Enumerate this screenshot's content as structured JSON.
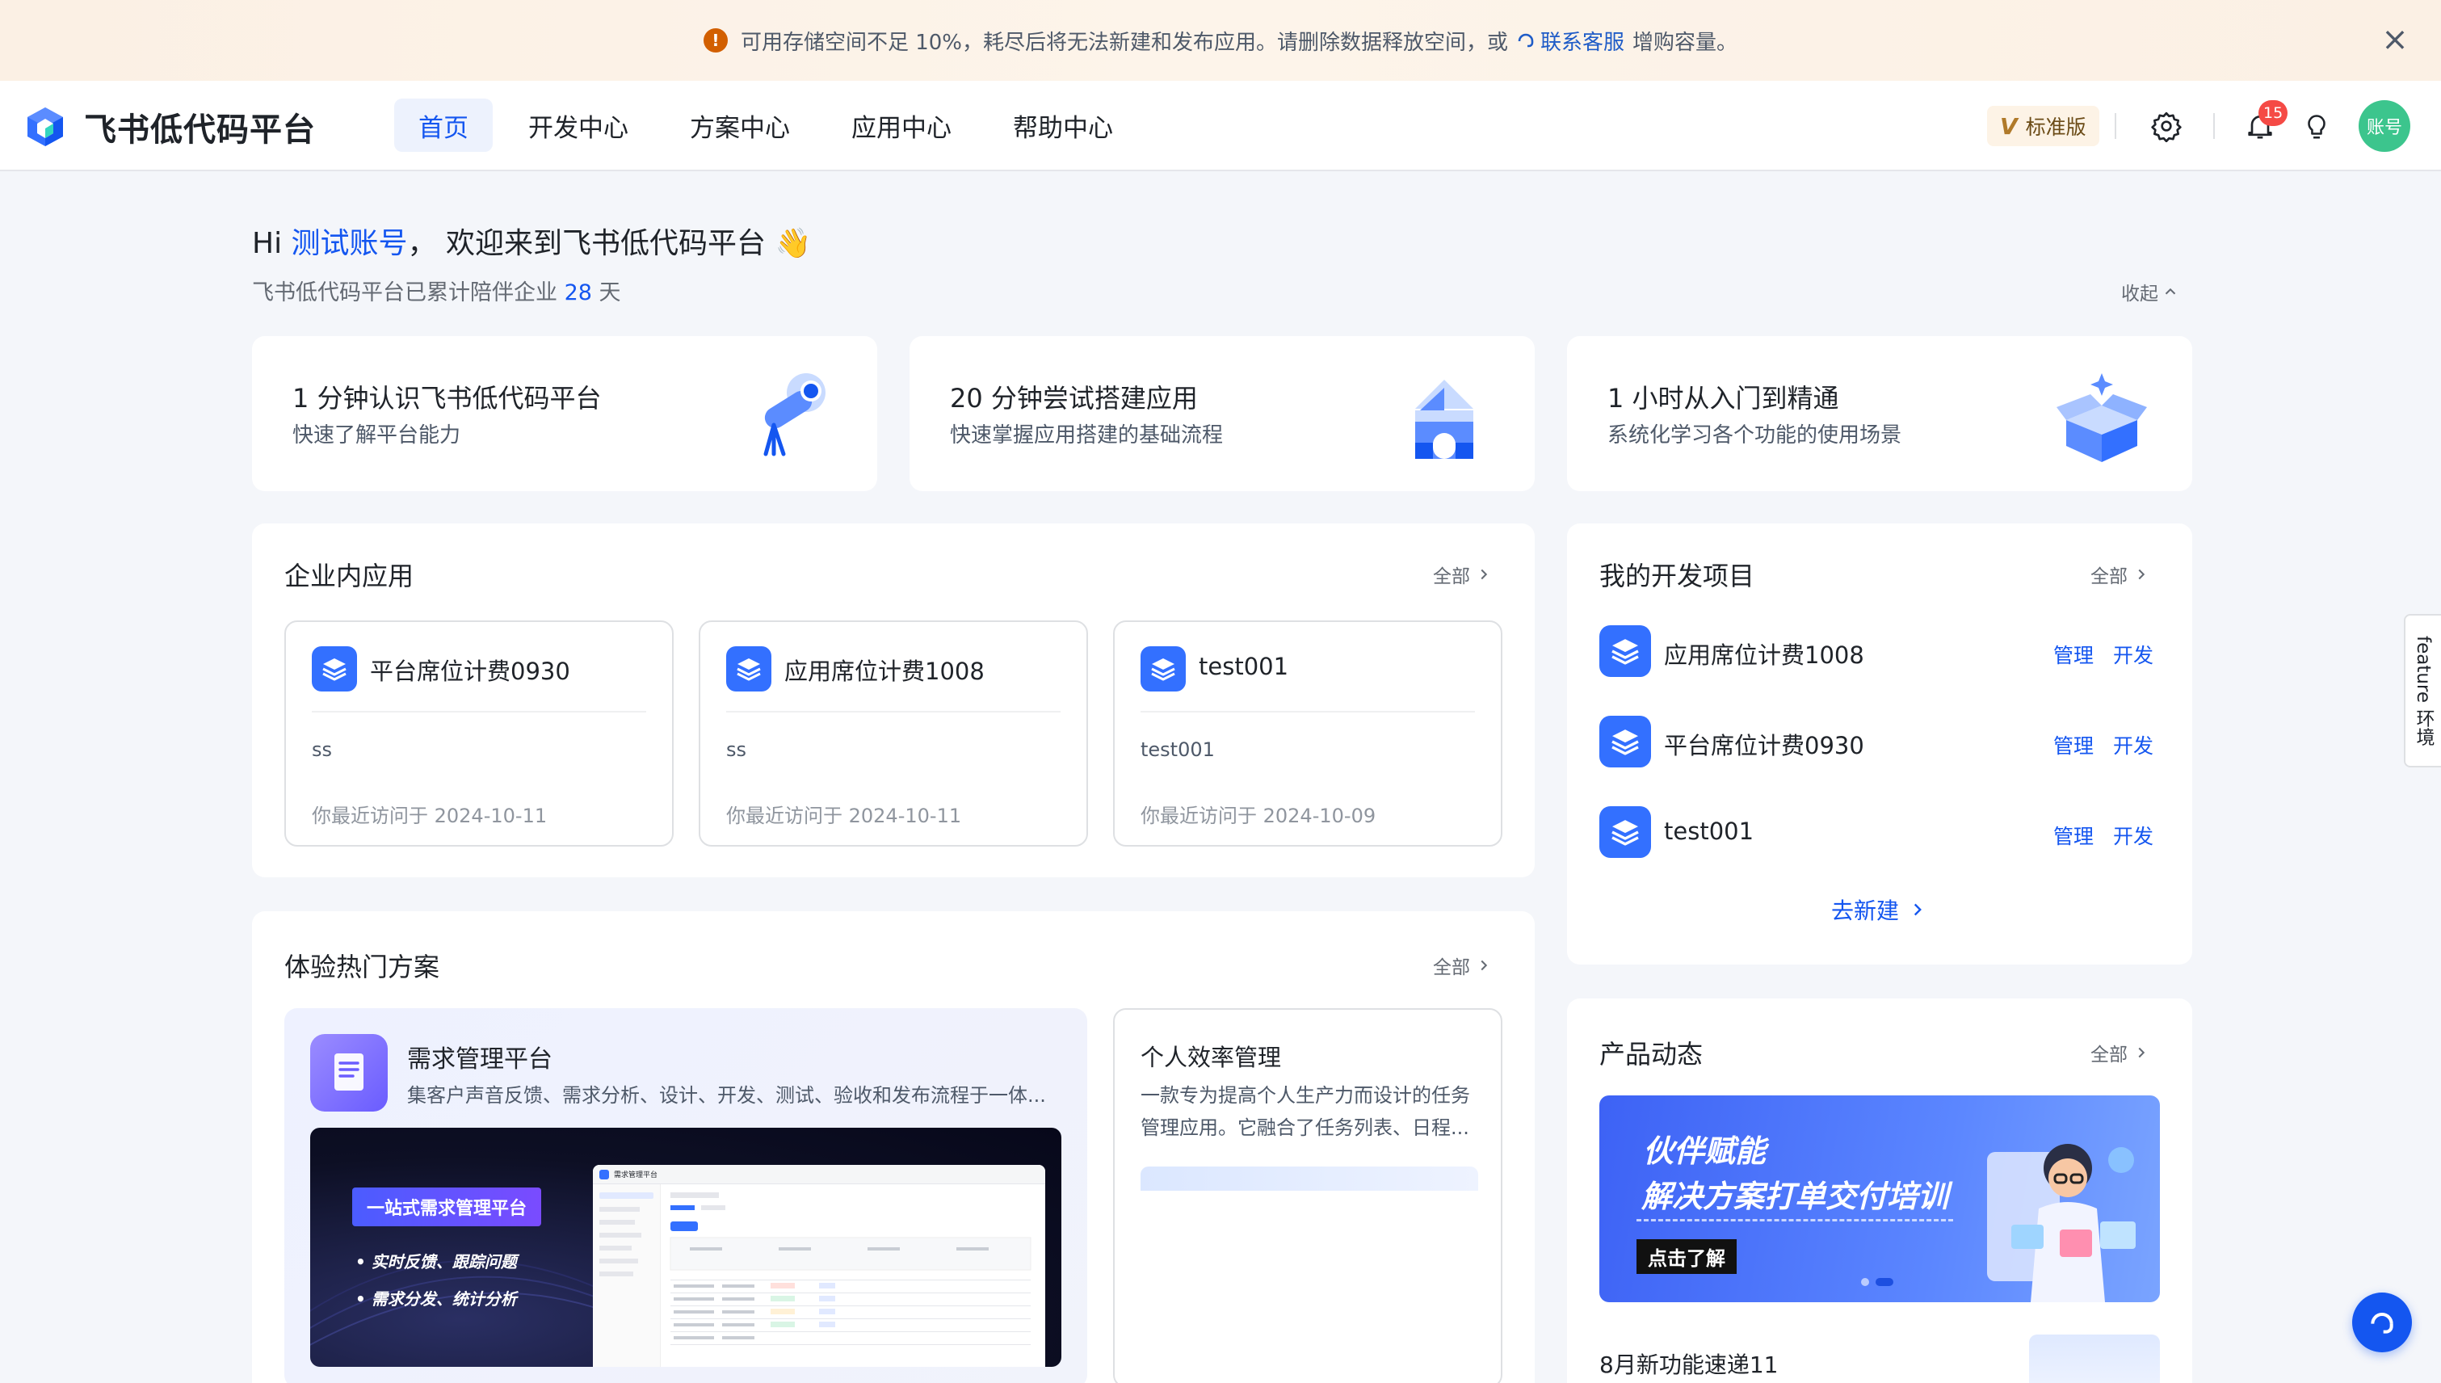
{
  "banner": {
    "message": "可用存储空间不足 10%，耗尽后将无法新建和发布应用。请删除数据释放空间，或",
    "link": "联系客服",
    "suffix": "增购容量。"
  },
  "nav": {
    "brand": "飞书低代码平台",
    "tabs": [
      "首页",
      "开发中心",
      "方案中心",
      "应用中心",
      "帮助中心"
    ],
    "version": "标准版",
    "notification_count": "15",
    "avatar_text": "账号"
  },
  "greeting": {
    "hi": "Hi",
    "username": "测试账号",
    "welcome": "，  欢迎来到飞书低代码平台",
    "emoji": "👋",
    "accompany_prefix": "飞书低代码平台已累计陪伴企业",
    "days": "28",
    "days_unit": "天",
    "collapse": "收起"
  },
  "guides": [
    {
      "title": "1 分钟认识飞书低代码平台",
      "desc": "快速了解平台能力"
    },
    {
      "title": "20 分钟尝试搭建应用",
      "desc": "快速掌握应用搭建的基础流程"
    },
    {
      "title": "1 小时从入门到精通",
      "desc": "系统化学习各个功能的使用场景"
    }
  ],
  "enterprise_apps": {
    "title": "企业内应用",
    "all": "全部",
    "apps": [
      {
        "name": "平台席位计费0930",
        "desc": "ss",
        "visited": "你最近访问于 2024-10-11"
      },
      {
        "name": "应用席位计费1008",
        "desc": "ss",
        "visited": "你最近访问于 2024-10-11"
      },
      {
        "name": "test001",
        "desc": "test001",
        "visited": "你最近访问于 2024-10-09"
      }
    ]
  },
  "my_projects": {
    "title": "我的开发项目",
    "all": "全部",
    "items": [
      {
        "name": "应用席位计费1008",
        "manage": "管理",
        "develop": "开发"
      },
      {
        "name": "平台席位计费0930",
        "manage": "管理",
        "develop": "开发"
      },
      {
        "name": "test001",
        "manage": "管理",
        "develop": "开发"
      }
    ],
    "create": "去新建"
  },
  "hot_solutions": {
    "title": "体验热门方案",
    "all": "全部",
    "featured": {
      "title": "需求管理平台",
      "desc": "集客户声音反馈、需求分析、设计、开发、测试、验收和发布流程于一体...",
      "banner_title": "一站式需求管理平台",
      "bullets": [
        "实时反馈、跟踪问题",
        "需求分发、统计分析"
      ],
      "mock_app_title": "需求管理平台"
    },
    "second": {
      "title": "个人效率管理",
      "desc_line1": "一款专为提高个人生产力而设计的任务",
      "desc_line2": "管理应用。它融合了任务列表、日程..."
    }
  },
  "product_news": {
    "title": "产品动态",
    "all": "全部",
    "banner_line1": "伙伴赋能",
    "banner_line2": "解决方案打单交付培训",
    "banner_cta": "点击了解",
    "news_item": "8月新功能速递11"
  },
  "side_tab": "feature 环境"
}
